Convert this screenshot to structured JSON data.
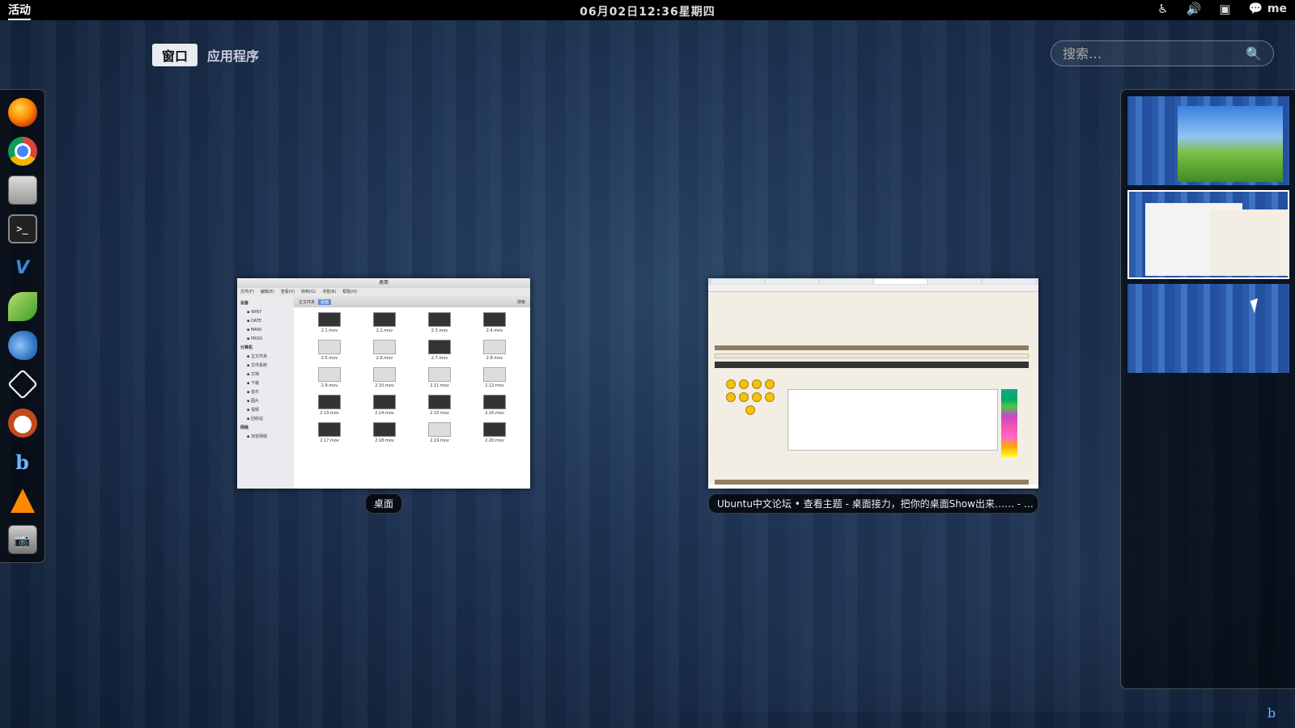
{
  "topbar": {
    "activities": "活动",
    "clock": "06月02日12:36星期四",
    "user": "me",
    "tray_icons": [
      "accessibility-icon",
      "volume-icon",
      "network-icon",
      "chat-icon"
    ]
  },
  "view_selector": {
    "windows": "窗口",
    "applications": "应用程序"
  },
  "search": {
    "placeholder": "搜索…"
  },
  "dash": {
    "apps": [
      "firefox",
      "chrome",
      "files",
      "terminal",
      "vim",
      "leafpad",
      "fish",
      "virtualbox",
      "panda",
      "baidu",
      "vlc",
      "screenshot"
    ]
  },
  "windows": [
    {
      "label": "桌面",
      "title": "桌面",
      "menu": [
        "文件(F)",
        "编辑(E)",
        "查看(V)",
        "转到(G)",
        "书签(B)",
        "帮助(H)"
      ],
      "toolbar": [
        "主文件夹",
        "桌面",
        "搜索"
      ],
      "sidebar": {
        "sections": [
          {
            "header": "设备",
            "items": [
              "WIN7",
              "DATE",
              "MAIN",
              "PROG"
            ]
          },
          {
            "header": "计算机",
            "items": [
              "主文件夹",
              "文件系统",
              "文档",
              "下载",
              "音乐",
              "图片",
              "视频",
              "回收站"
            ]
          },
          {
            "header": "网络",
            "items": [
              "浏览网络"
            ]
          }
        ]
      },
      "files": [
        "2.1.mov",
        "2.2.mov",
        "2.3.mov",
        "2.4.mov",
        "2.5.mov",
        "2.6.mov",
        "2.7.mov",
        "2.8.mov",
        "2.9.mov",
        "2.10.mov",
        "2.11.mov",
        "2.12.mov",
        "2.13.mov",
        "2.14.mov",
        "2.15.mov",
        "2.16.mov",
        "2.17.mov",
        "2.18.mov",
        "2.19.mov",
        "2.20.mov"
      ]
    },
    {
      "label": "Ubuntu中文论坛 • 查看主题 - 桌面接力，把你的桌面Show出来…… - …"
    }
  ],
  "workspaces": [
    {
      "name": "workspace-1",
      "active": false
    },
    {
      "name": "workspace-2",
      "active": true
    },
    {
      "name": "workspace-3",
      "active": false
    }
  ]
}
